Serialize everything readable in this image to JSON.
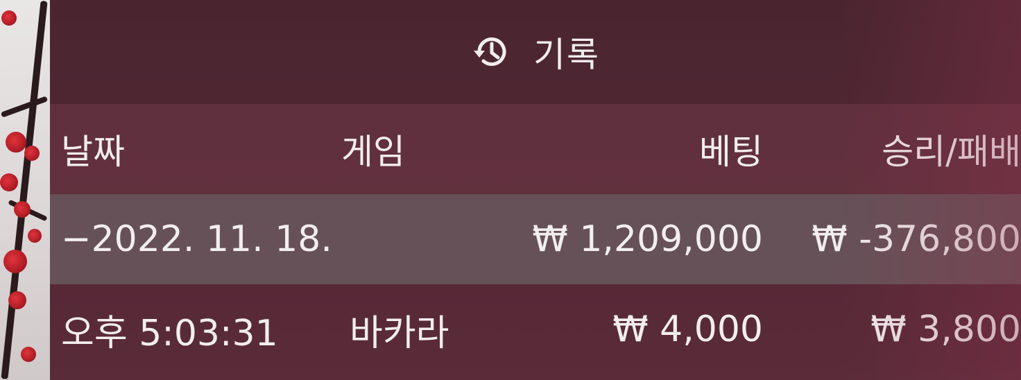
{
  "title": {
    "icon": "history-icon",
    "label": "기록"
  },
  "table": {
    "columns": [
      "날짜",
      "게임",
      "베팅",
      "승리/패배"
    ],
    "date_group": {
      "date": "−2022. 11. 18.",
      "bet_total": "₩ 1,209,000",
      "result_total": "₩ -376,800"
    },
    "rows": [
      {
        "time": "오후 5:03:31",
        "game": "바카라",
        "bet": "₩ 4,000",
        "result": "₩ 3,800"
      }
    ]
  },
  "colors": {
    "panel": "#4f2733",
    "header_row": "#6a3644",
    "date_row": "#6e5f64",
    "text": "#f2eef0"
  }
}
